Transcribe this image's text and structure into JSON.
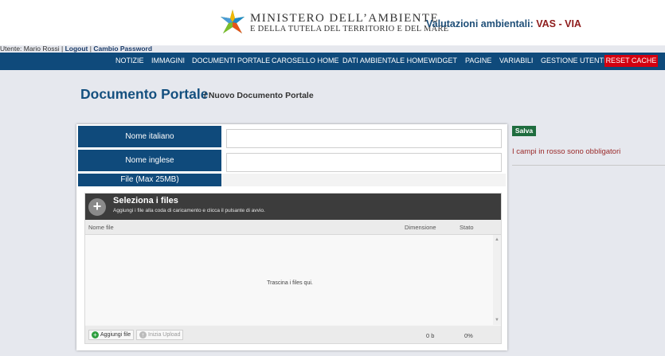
{
  "header": {
    "ministry_line1": "MINISTERO DELL’AMBIENTE",
    "ministry_line2": "E DELLA TUTELA DEL TERRITORIO E DEL MARE",
    "portal_label": "Valutazioni ambientali:",
    "portal_highlight": "VAS - VIA",
    "logo_icon": "ministry-star-logo"
  },
  "userbar": {
    "user_text": "Utente: Mario Rossi |",
    "logout": "Logout",
    "sep": "|",
    "change_password": "Cambio Password"
  },
  "nav": {
    "items": [
      "NOTIZIE",
      "IMMAGINI",
      "DOCUMENTI PORTALE",
      "CAROSELLO HOME",
      "DATI AMBIENTALE HOME",
      "WIDGET",
      "PAGINE",
      "VARIABILI",
      "GESTIONE UTENTI"
    ],
    "reset_label": "RESET CACHE",
    "reset_color": "#d4000f",
    "bar_color": "#0f4a7b"
  },
  "page": {
    "title": "Documento Portale",
    "subtitle": "/ Nuovo Documento Portale"
  },
  "form": {
    "label_it": "Nome italiano",
    "value_it": "",
    "label_en": "Nome inglese",
    "value_en": "",
    "label_file": "File (Max 25MB)"
  },
  "uploader": {
    "title": "Seleziona i files",
    "subtitle": "Aggiungi i file alla coda di caricamento e clicca il pulsante di avvio.",
    "col_name": "Nome file",
    "col_size": "Dimensione",
    "col_status": "Stato",
    "drop_text": "Trascina i files qui.",
    "add_button": "Aggiungi file",
    "start_button": "Inizia Upload",
    "total_size": "0 b",
    "percent": "0%"
  },
  "sidebar": {
    "save_label": "Salva",
    "required_note": "I campi in rosso sono obbligatori",
    "save_color": "#1f6d3f"
  }
}
